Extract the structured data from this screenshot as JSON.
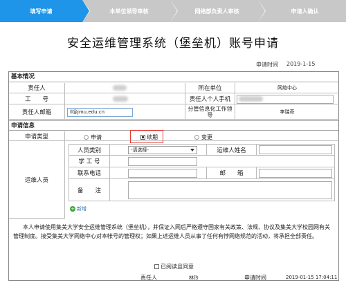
{
  "steps": [
    "填写申请",
    "本单位领导审核",
    "网络部负责人审核",
    "申请人确认"
  ],
  "title": "安全运维管理系统（堡垒机）账号申请",
  "apply_time_label": "申请时间",
  "apply_time_value": "2019-1-15",
  "basic": {
    "section": "基本情况",
    "responsible_label": "责任人",
    "unit_label": "所在单位",
    "unit_value": "网络中心",
    "id_label": "工　　号",
    "mobile_label": "责任人个人手机",
    "email_label": "责任人邮箱",
    "email_value": "ll@jmu.edu.cn",
    "leader_label": "分管信息化工作领导",
    "leader_value": "李瑞奇"
  },
  "apply": {
    "section": "申请信息",
    "type_label": "申请类型",
    "options": [
      "申请",
      "续期",
      "变更"
    ],
    "selected": "续期",
    "ops_label": "运维人员",
    "staff_type_label": "人员类别",
    "staff_type_value": "-请选择-",
    "ops_name_label": "运维人姓名",
    "student_id_label": "学 工 号",
    "phone_label": "联系电话",
    "mail_label": "邮　　箱",
    "remark_label": "备　　注",
    "add_label": "新增"
  },
  "notice": "本人申请使用集美大学安全运维管理系统（堡垒机），并保证入网后严格遵守国家有关政策、法规、协议及集美大学校园网有关管理制度。接受集美大学网络中心对本帐号的管理权；如果上述运维人员从事了任何有悖网络规范的活动，将承担全部责任。",
  "agree_label": "已阅读且同意",
  "footer": {
    "responsible_label": "责任人",
    "responsible_value": "林玲",
    "time_label": "申请时间",
    "time_value": "2019-01-15 17:04:11"
  }
}
